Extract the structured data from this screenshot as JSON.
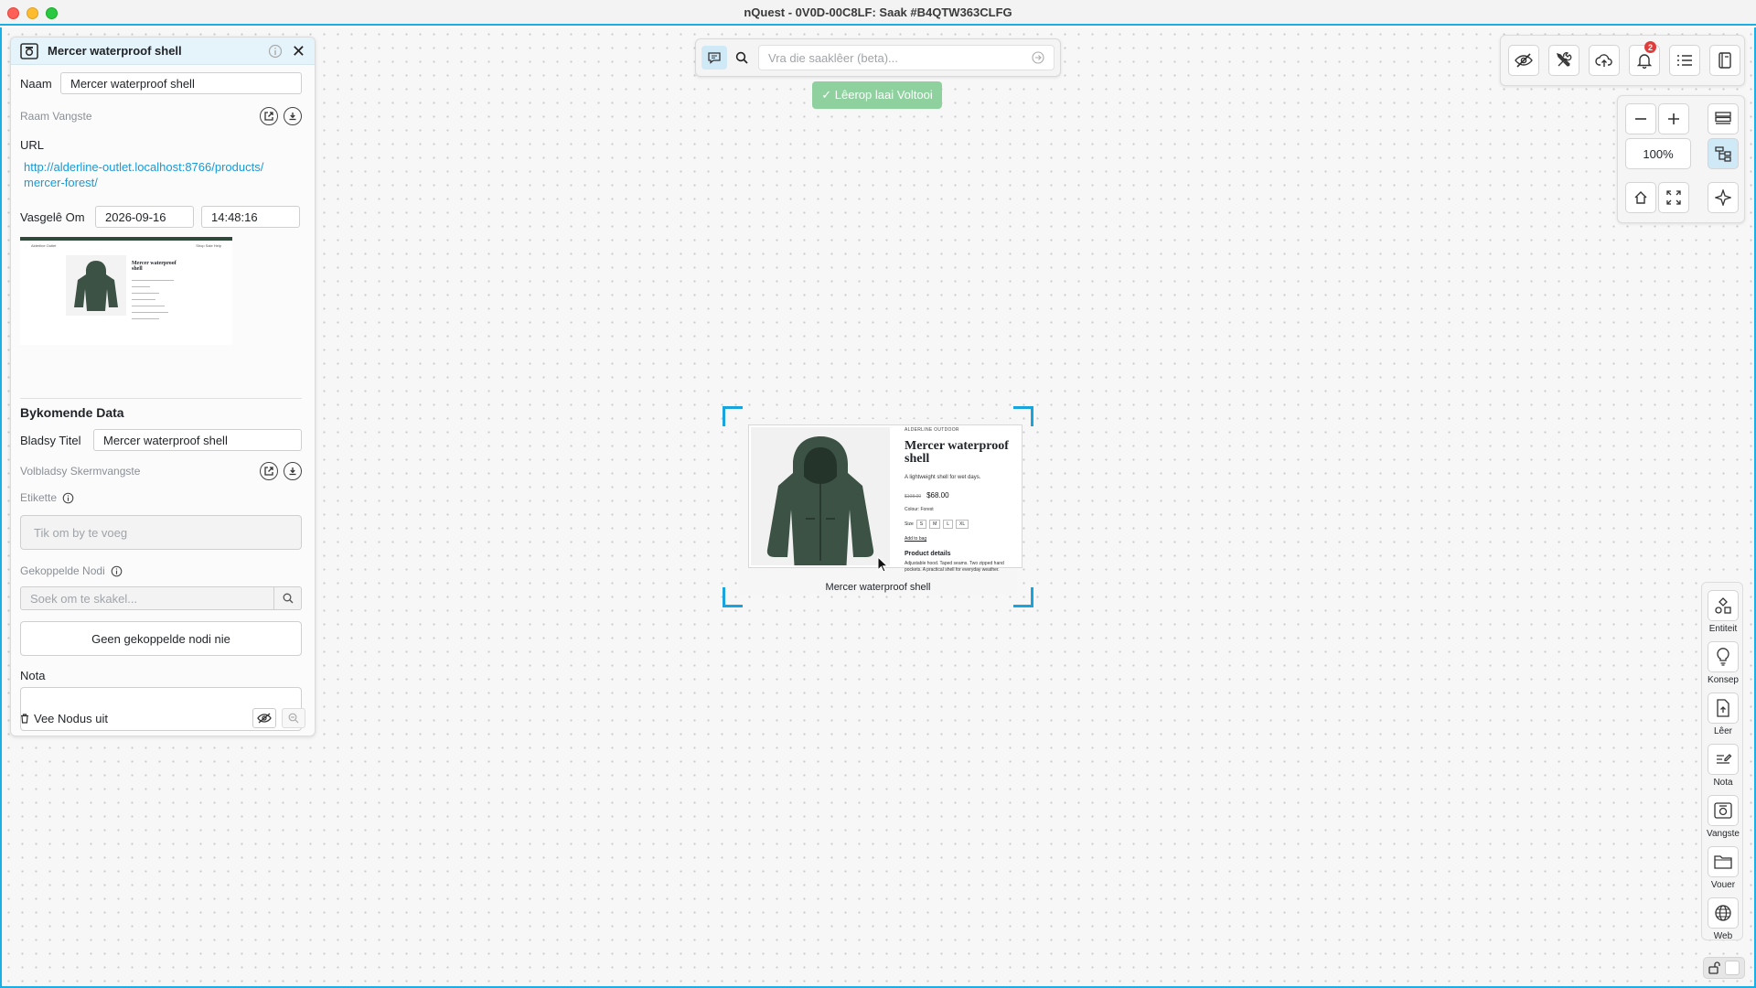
{
  "window": {
    "title": "nQuest - 0V0D-00C8LF: Saak #B4QTW363CLFG"
  },
  "panel": {
    "title": "Mercer waterproof shell",
    "name_label": "Naam",
    "name_value": "Mercer waterproof shell",
    "frame_capture_label": "Raam Vangste",
    "url_label": "URL",
    "url_line1": "http://alderline-outlet.localhost:8766/products/",
    "url_line2": "mercer-forest/",
    "captured_label": "Vasgelê Om",
    "captured_date": "2026-09-16",
    "captured_time": "14:48:16",
    "additional_data_heading": "Bykomende Data",
    "page_title_label": "Bladsy Titel",
    "page_title_value": "Mercer waterproof shell",
    "fullpage_capture_label": "Volbladsy Skermvangste",
    "tags_label": "Etikette",
    "tags_placeholder": "Tik om by te voeg",
    "linked_nodes_label": "Gekoppelde Nodi",
    "linked_search_placeholder": "Soek om te skakel...",
    "no_linked_nodes": "Geen gekoppelde nodi nie",
    "note_label": "Nota",
    "note_value": "",
    "delete_node_label": "Vee Nodus uit"
  },
  "thumbnail": {
    "brand": "Alderline Outlet",
    "nav": "Shop  Sale  Help",
    "title": "Mercer waterproof shell"
  },
  "askbar": {
    "placeholder": "Vra die saaklêer (beta)..."
  },
  "toast": {
    "text": "✓ Lêerop laai Voltooi"
  },
  "toolbar": {
    "notification_count": "2",
    "zoom_level": "100%"
  },
  "sidebar_right": {
    "items": [
      {
        "label": "Entiteit",
        "icon": "entity-icon"
      },
      {
        "label": "Konsep",
        "icon": "lightbulb-icon"
      },
      {
        "label": "Lêer",
        "icon": "file-upload-icon"
      },
      {
        "label": "Nota",
        "icon": "note-icon"
      },
      {
        "label": "Vangste",
        "icon": "camera-icon"
      },
      {
        "label": "Vouer",
        "icon": "folder-icon"
      },
      {
        "label": "Web",
        "icon": "globe-icon"
      }
    ]
  },
  "node": {
    "caption": "Mercer waterproof shell",
    "shot": {
      "brand": "ALDERLINE OUTDOOR",
      "title": "Mercer waterproof shell",
      "subtitle": "A lightweight shell for wet days.",
      "old_price": "$108.00",
      "price": "$68.00",
      "colour": "Colour: Forest",
      "size_label": "Size",
      "sizes": [
        "S",
        "M",
        "L",
        "XL"
      ],
      "add_to_bag": "Add to bag",
      "details_heading": "Product details",
      "details_text": "Adjustable hood. Taped seams. Two zipped hand pockets. A practical shell for everyday weather."
    }
  },
  "colors": {
    "accent": "#1ab0e6",
    "toast": "#8fd19e",
    "badge": "#e23b3b",
    "jacket": "#3b5245"
  }
}
